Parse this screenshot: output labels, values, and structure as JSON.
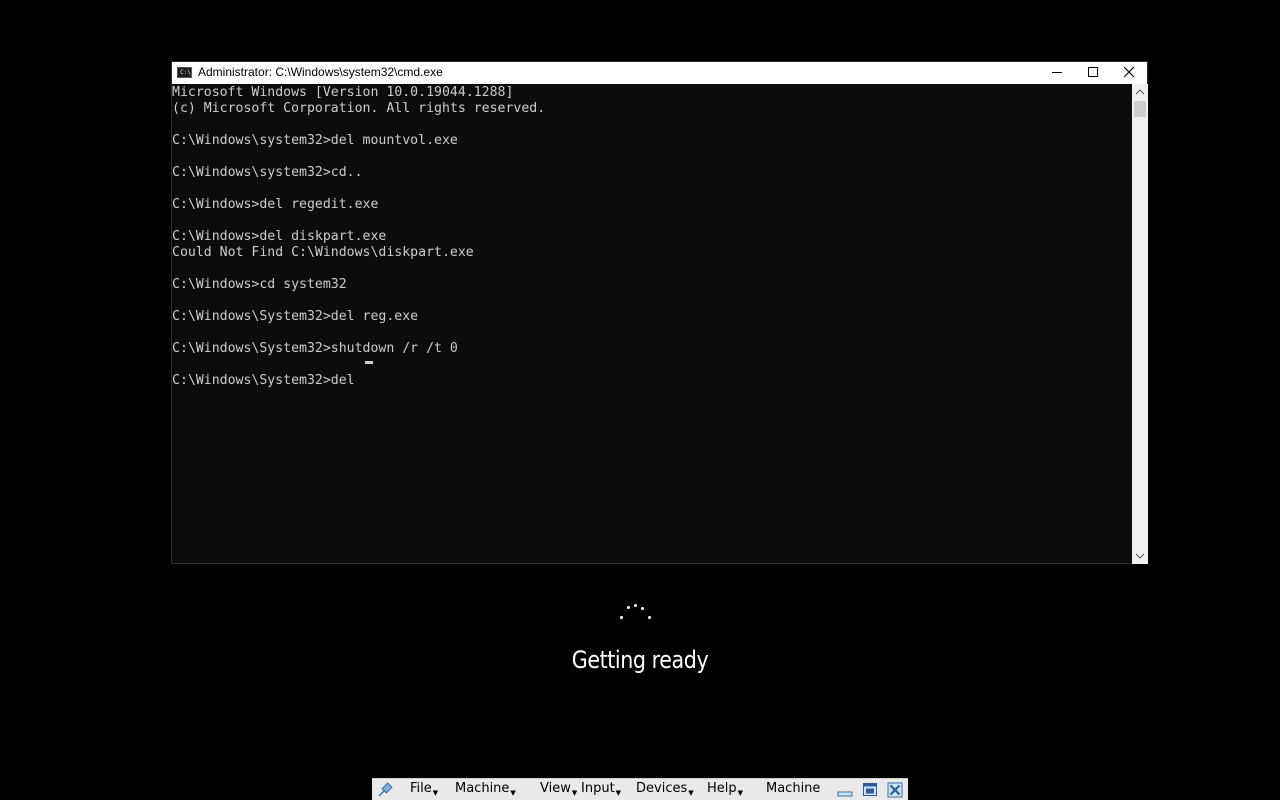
{
  "window": {
    "title": "Administrator: C:\\Windows\\system32\\cmd.exe",
    "icon": "cmd-icon",
    "icon_text": "C:\\."
  },
  "console": {
    "lines": [
      "Microsoft Windows [Version 10.0.19044.1288]",
      "(c) Microsoft Corporation. All rights reserved.",
      "",
      "C:\\Windows\\system32>del mountvol.exe",
      "",
      "C:\\Windows\\system32>cd..",
      "",
      "C:\\Windows>del regedit.exe",
      "",
      "C:\\Windows>del diskpart.exe",
      "Could Not Find C:\\Windows\\diskpart.exe",
      "",
      "C:\\Windows>cd system32",
      "",
      "C:\\Windows\\System32>del reg.exe",
      "",
      "C:\\Windows\\System32>shutdown /r /t 0",
      "",
      "C:\\Windows\\System32>del "
    ]
  },
  "status": {
    "text": "Getting ready"
  },
  "vbox_menu": {
    "items": [
      "File",
      "Machine",
      "View",
      "Input",
      "Devices",
      "Help"
    ],
    "label": "Machine"
  },
  "colors": {
    "console_bg": "#0c0c0c",
    "console_fg": "#cccccc",
    "desktop_bg": "#000000"
  }
}
